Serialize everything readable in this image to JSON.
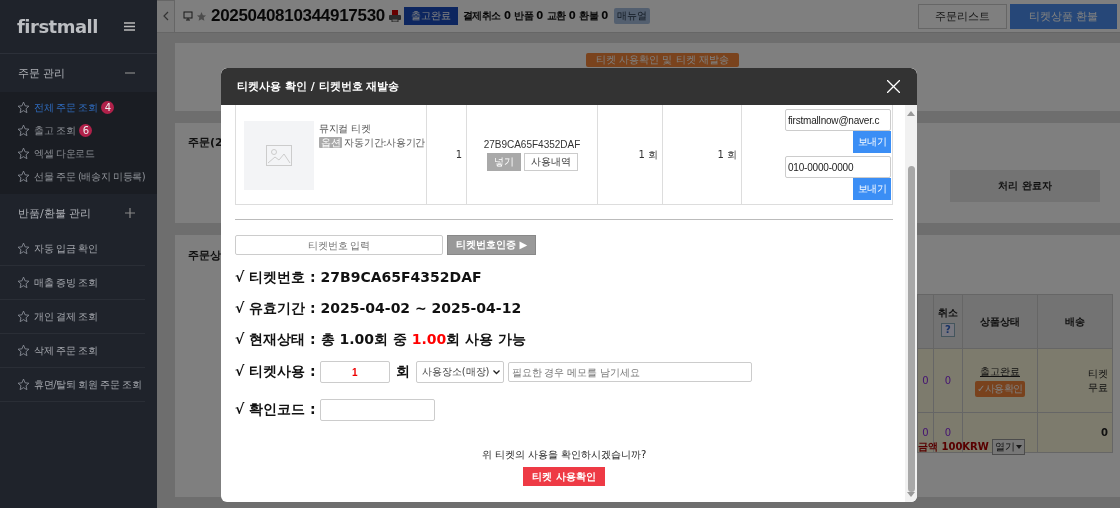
{
  "sidebar": {
    "logo": "firstmall",
    "sections": [
      {
        "title": "주문 관리",
        "expanded": true,
        "items": [
          {
            "label": "전체 주문 조회",
            "selected": true,
            "badge": "4"
          },
          {
            "label": "출고 조회",
            "selected": false,
            "badge": "6"
          },
          {
            "label": "엑셀 다운로드",
            "selected": false
          },
          {
            "label": "선물 주문 (배송지 미등록)",
            "selected": false
          }
        ]
      },
      {
        "title": "반품/환불 관리",
        "expanded": false
      }
    ],
    "links": [
      "자동 입금 확인",
      "매출 증빙 조회",
      "개인 결제 조회",
      "삭제 주문 조회",
      "휴면/탈퇴 회원 주문 조회"
    ]
  },
  "header": {
    "order_number": "2025040810344917530",
    "status_badge": "출고완료",
    "counts": [
      {
        "label": "결제취소",
        "value": "0"
      },
      {
        "label": "반품",
        "value": "0"
      },
      {
        "label": "교환",
        "value": "0"
      },
      {
        "label": "환불",
        "value": "0"
      }
    ],
    "manual": "매뉴얼",
    "buttons": [
      {
        "label": "주문리스트",
        "kind": "default"
      },
      {
        "label": "티켓상품 환불",
        "kind": "primary"
      }
    ]
  },
  "page": {
    "ticket_action": "티켓 사용확인 및 티켓 재발송",
    "panel_titles": [
      "주문(2",
      "주문상"
    ],
    "handler_column": "처리 완료자",
    "table": {
      "columns": [
        "취소",
        "상품상태",
        "배송"
      ],
      "cancel_help": "?",
      "rows": [
        {
          "column_1": "0",
          "cancel": "0",
          "status": "출고완료",
          "status_tag": "✓사용확인",
          "shipping": "티켓 무료"
        },
        {
          "column_1": "0",
          "cancel": "0",
          "shipping": "0"
        }
      ]
    },
    "total": "금액 100KRW",
    "total_toggle": "열기"
  },
  "modal": {
    "title": "티켓사용 확인 / 티켓번호 재발송",
    "product": {
      "name": "뮤지컬 티켓",
      "option_tag": "옵션",
      "option": "자동기간:사용기간",
      "quantity": "1",
      "ticket_code": "27B9CA65F4352DAF",
      "buttons": [
        {
          "label": "넣기",
          "kind": "grey"
        },
        {
          "label": "사용내역",
          "kind": "outline"
        }
      ],
      "used": "1 회",
      "remaining": "1 회",
      "contacts": [
        {
          "value": "firstmallnow@naver.c",
          "button": "보내기"
        },
        {
          "value": "010-0000-0000",
          "button": "보내기"
        }
      ]
    },
    "verify": {
      "placeholder": "티켓번호 입력",
      "button": "티켓번호인증 ▶"
    },
    "info": [
      {
        "text": "√ 티켓번호 : 27B9CA65F4352DAF"
      },
      {
        "text": "√ 유효기간 : 2025-04-02 ~ 2025-04-12"
      },
      {
        "text": "√ 현재상태 : 총 1.00회 중 ",
        "highlight": "1.00",
        "after": "회 사용 가능"
      }
    ],
    "use": {
      "label": "√ 티켓사용 :",
      "value": "1",
      "unit": "회",
      "place": "사용장소(매장)",
      "memo_placeholder": "필요한 경우 메모를 남기세요"
    },
    "code": {
      "label": "√ 확인코드 :"
    },
    "question": "위 티켓의 사용을 확인하시겠습니까?",
    "confirm_button": "티켓 사용확인"
  }
}
